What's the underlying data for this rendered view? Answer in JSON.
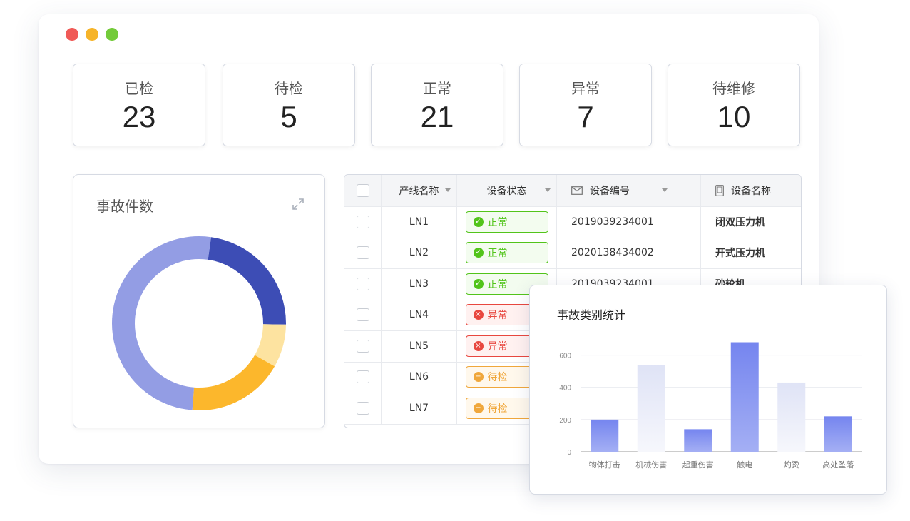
{
  "stats": [
    {
      "label": "已检",
      "value": "23"
    },
    {
      "label": "待检",
      "value": "5"
    },
    {
      "label": "正常",
      "value": "21"
    },
    {
      "label": "异常",
      "value": "7"
    },
    {
      "label": "待维修",
      "value": "10"
    }
  ],
  "donut": {
    "title": "事故件数",
    "colors": [
      "#3d4db5",
      "#fde3a0",
      "#fcb72c",
      "#939de4"
    ],
    "segments": [
      23,
      8,
      18,
      51
    ]
  },
  "table": {
    "headers": {
      "line": "产线名称",
      "status": "设备状态",
      "code": "设备编号",
      "name": "设备名称"
    },
    "rows": [
      {
        "line": "LN1",
        "status": "正常",
        "kind": "ok",
        "code": "2019039234001",
        "name": "闭双压力机"
      },
      {
        "line": "LN2",
        "status": "正常",
        "kind": "ok",
        "code": "2020138434002",
        "name": "开式压力机"
      },
      {
        "line": "LN3",
        "status": "正常",
        "kind": "ok",
        "code": "2019039234001",
        "name": "砂轮机"
      },
      {
        "line": "LN4",
        "status": "异常",
        "kind": "bad",
        "code": "",
        "name": ""
      },
      {
        "line": "LN5",
        "status": "异常",
        "kind": "bad",
        "code": "",
        "name": ""
      },
      {
        "line": "LN6",
        "status": "待检",
        "kind": "wait",
        "code": "",
        "name": ""
      },
      {
        "line": "LN7",
        "status": "待检",
        "kind": "wait",
        "code": "",
        "name": ""
      }
    ]
  },
  "chart_data": {
    "type": "bar",
    "title": "事故类别统计",
    "categories": [
      "物体打击",
      "机械伤害",
      "起重伤害",
      "触电",
      "灼烫",
      "高处坠落"
    ],
    "values": [
      200,
      540,
      140,
      680,
      430,
      220
    ],
    "ylim": [
      0,
      700
    ],
    "yticks": [
      0,
      200,
      400,
      600
    ],
    "grid": true,
    "bar_colors": [
      "#7c8cf0",
      "#e3e7f7",
      "#7c8cf0",
      "#7c8cf0",
      "#e3e7f7",
      "#7c8cf0"
    ]
  }
}
